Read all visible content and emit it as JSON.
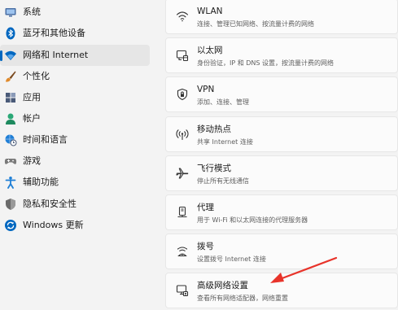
{
  "sidebar": {
    "items": [
      {
        "label": "系统",
        "icon": "system-icon",
        "color": "#4a6fa5"
      },
      {
        "label": "蓝牙和其他设备",
        "icon": "bluetooth-icon",
        "color": "#0067c0"
      },
      {
        "label": "网络和 Internet",
        "icon": "wifi-icon",
        "color": "#0067c0",
        "selected": true
      },
      {
        "label": "个性化",
        "icon": "brush-icon",
        "color": "#e08a2c"
      },
      {
        "label": "应用",
        "icon": "apps-icon",
        "color": "#4a5a78"
      },
      {
        "label": "帐户",
        "icon": "account-icon",
        "color": "#2aa876"
      },
      {
        "label": "时间和语言",
        "icon": "globe-clock-icon",
        "color": "#1f7fd6"
      },
      {
        "label": "游戏",
        "icon": "gamepad-icon",
        "color": "#7a7a7a"
      },
      {
        "label": "辅助功能",
        "icon": "accessibility-icon",
        "color": "#1f7fd6"
      },
      {
        "label": "隐私和安全性",
        "icon": "shield-icon",
        "color": "#6b6b6b"
      },
      {
        "label": "Windows 更新",
        "icon": "update-icon",
        "color": "#0067c0"
      }
    ]
  },
  "main": {
    "cards": [
      {
        "title": "WLAN",
        "subtitle": "连接、管理已知网络、按流量计费的网络",
        "icon": "wlan-icon"
      },
      {
        "title": "以太网",
        "subtitle": "身份验证，IP 和 DNS 设置，按流量计费的网络",
        "icon": "ethernet-icon"
      },
      {
        "title": "VPN",
        "subtitle": "添加、连接、管理",
        "icon": "vpn-shield-icon"
      },
      {
        "title": "移动热点",
        "subtitle": "共享 Internet 连接",
        "icon": "hotspot-icon"
      },
      {
        "title": "飞行模式",
        "subtitle": "停止所有无线通信",
        "icon": "airplane-icon"
      },
      {
        "title": "代理",
        "subtitle": "用于 Wi-Fi 和以太网连接的代理服务器",
        "icon": "proxy-icon"
      },
      {
        "title": "拨号",
        "subtitle": "设置拨号 Internet 连接",
        "icon": "dialup-icon"
      },
      {
        "title": "高级网络设置",
        "subtitle": "查看所有网络适配器，网络重置",
        "icon": "advanced-network-icon"
      }
    ]
  },
  "annotation": {
    "arrow_color": "#e8332a"
  },
  "colors": {
    "accent": "#0067c0",
    "background": "#f3f3f3",
    "card": "#fbfbfb"
  }
}
